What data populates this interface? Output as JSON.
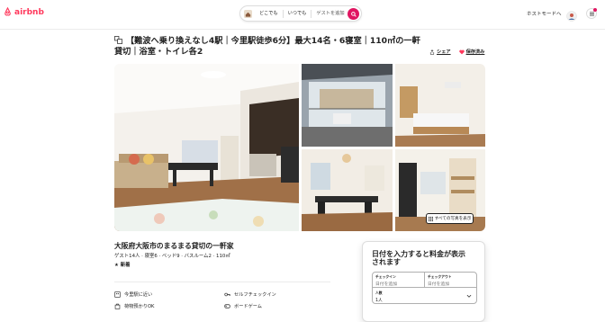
{
  "header": {
    "logo_text": "airbnb",
    "search": {
      "where": "どこでも",
      "when": "いつでも",
      "guests": "ゲストを追加"
    },
    "host_mode": "ホストモードへ"
  },
  "listing": {
    "title": "【難波へ乗り換えなし4駅｜今里駅徒歩6分】最大14名・6寝室｜110㎡の一軒貸切｜浴室・トイレ各2",
    "share": "シェア",
    "saved": "保存済み",
    "show_all_photos": "すべての写真を表示",
    "subtitle": "大阪府大阪市のまるまる貸切の一軒家",
    "details": "ゲスト14人 · 寝室6 · ベッド9 · バスルーム2 · 110㎡",
    "rating": "★ 新着"
  },
  "amenities": [
    {
      "icon": "building-icon",
      "label": "今里駅に近い"
    },
    {
      "icon": "key-icon",
      "label": "セルフチェックイン"
    },
    {
      "icon": "luggage-icon",
      "label": "荷物預かりOK"
    },
    {
      "icon": "game-icon",
      "label": "ボードゲーム"
    }
  ],
  "booking": {
    "prompt": "日付を入力すると料金が表示されます",
    "checkin_label": "チェックイン",
    "checkin_value": "日付を追加",
    "checkout_label": "チェックアウト",
    "checkout_value": "日付を追加",
    "guests_label": "人数",
    "guests_value": "1人"
  },
  "colors": {
    "brand": "#ff385c",
    "search_button": "#e01561"
  }
}
